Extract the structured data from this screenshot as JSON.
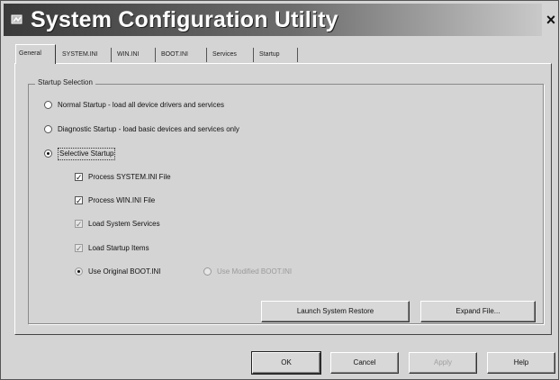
{
  "window": {
    "title": "System Configuration Utility",
    "close_glyph": "×",
    "icon": "msconfig-icon"
  },
  "tabs": [
    {
      "label": "General",
      "active": true
    },
    {
      "label": "SYSTEM.INI",
      "active": false
    },
    {
      "label": "WIN.INI",
      "active": false
    },
    {
      "label": "BOOT.INI",
      "active": false
    },
    {
      "label": "Services",
      "active": false
    },
    {
      "label": "Startup",
      "active": false
    }
  ],
  "startup_selection": {
    "group_label": "Startup Selection",
    "normal_label": "Normal Startup - load all device drivers and services",
    "diagnostic_label": "Diagnostic Startup - load basic devices and services only",
    "selective_label": "Selective Startup",
    "selected": "selective",
    "options": {
      "process_system_ini": {
        "label": "Process SYSTEM.INI File",
        "checked": true
      },
      "process_win_ini": {
        "label": "Process WIN.INI File",
        "checked": true
      },
      "load_system_services": {
        "label": "Load System Services",
        "checked": true
      },
      "load_startup_items": {
        "label": "Load Startup Items",
        "checked": true
      },
      "use_original_boot_ini": {
        "label": "Use Original BOOT.INI",
        "selected": true
      },
      "use_modified_boot_ini": {
        "label": "Use Modified BOOT.INI",
        "selected": false
      }
    }
  },
  "panel_buttons": {
    "launch_system_restore": "Launch System Restore",
    "expand_file": "Expand File..."
  },
  "dialog_buttons": {
    "ok": "OK",
    "cancel": "Cancel",
    "apply": "Apply",
    "help": "Help"
  }
}
